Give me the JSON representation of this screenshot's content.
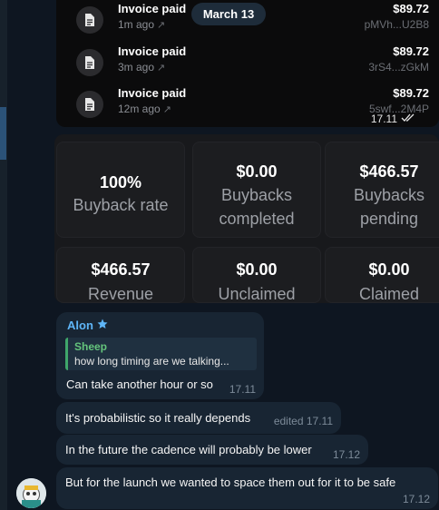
{
  "invoices": [
    {
      "title": "Invoice paid",
      "time": "1m ago",
      "amount": "$89.72",
      "hash": "pMVh...U2B8"
    },
    {
      "title": "Invoice paid",
      "time": "3m ago",
      "amount": "$89.72",
      "hash": "3rS4...zGkM"
    },
    {
      "title": "Invoice paid",
      "time": "12m ago",
      "amount": "$89.72",
      "hash": "5swf...2M4P"
    }
  ],
  "date_pill": "March 13",
  "invoice_message_time": "17.11",
  "stats": [
    {
      "value": "100%",
      "label_line1": "Buyback rate",
      "label_line2": ""
    },
    {
      "value": "$0.00",
      "label_line1": "Buybacks",
      "label_line2": "completed"
    },
    {
      "value": "$466.57",
      "label_line1": "Buybacks",
      "label_line2": "pending"
    },
    {
      "value": "$466.57",
      "label_line1": "Revenue",
      "label_line2": ""
    },
    {
      "value": "$0.00",
      "label_line1": "Unclaimed",
      "label_line2": ""
    },
    {
      "value": "$0.00",
      "label_line1": "Claimed",
      "label_line2": ""
    }
  ],
  "messages": {
    "sender": "Alon",
    "reply_to_name": "Sheep",
    "reply_to_text": "how long timing are we talking...",
    "m1_text": "Can take another hour or so",
    "m1_time": "17.11",
    "m2_text": "It's probabilistic so it really depends",
    "m2_meta": "edited 17.11",
    "m3_text": "In the future the cadence will probably be lower",
    "m3_time": "17.12",
    "m4_text": "But for the launch we wanted to space them out for it to be safe",
    "m4_time": "17.12"
  },
  "colors": {
    "background": "#0e1621",
    "bubble": "#182533",
    "sender": "#5eb5f7",
    "quote_accent": "#3fa66a"
  },
  "icons": [
    "document-icon",
    "external-link-icon",
    "double-check-icon",
    "star-icon"
  ]
}
